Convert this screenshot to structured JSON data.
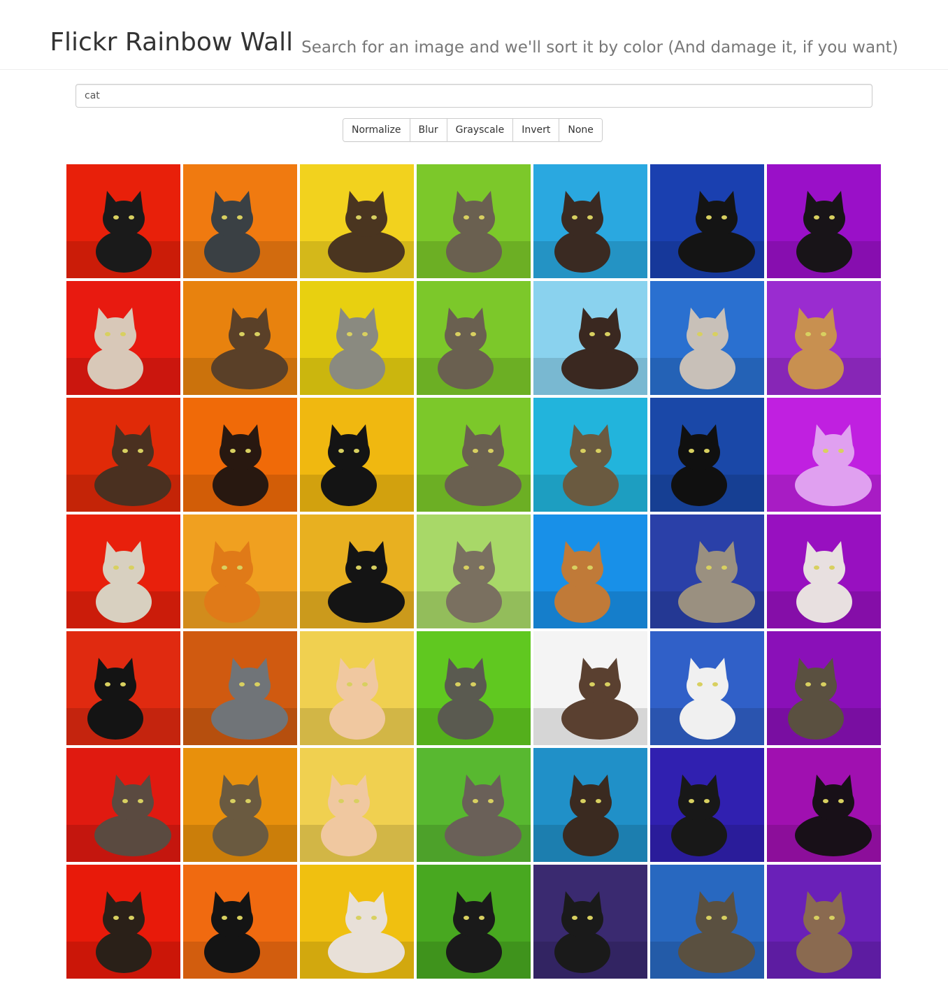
{
  "header": {
    "title": "Flickr Rainbow Wall",
    "subtitle": "Search for an image and we'll sort it by color (And damage it, if you want)"
  },
  "search": {
    "value": "cat"
  },
  "filters": [
    "Normalize",
    "Blur",
    "Grayscale",
    "Invert",
    "None"
  ],
  "grid": {
    "columns": 7,
    "rows": [
      [
        {
          "bg": "#e8200a",
          "cat": "#1a1a1a"
        },
        {
          "bg": "#f07a10",
          "cat": "#3a4044"
        },
        {
          "bg": "#f2d21e",
          "cat": "#4a3520"
        },
        {
          "bg": "#7cc82a",
          "cat": "#6a6050"
        },
        {
          "bg": "#2aa8e0",
          "cat": "#3a2a22"
        },
        {
          "bg": "#1a40b0",
          "cat": "#141414"
        },
        {
          "bg": "#9a10c8",
          "cat": "#181418"
        }
      ],
      [
        {
          "bg": "#e81a10",
          "cat": "#d8c8b8"
        },
        {
          "bg": "#e8820e",
          "cat": "#5a4028"
        },
        {
          "bg": "#e8d010",
          "cat": "#8a8a80"
        },
        {
          "bg": "#7cc82a",
          "cat": "#6a6050"
        },
        {
          "bg": "#8ad2ee",
          "cat": "#3a2820"
        },
        {
          "bg": "#2a70d0",
          "cat": "#c8c0b8"
        },
        {
          "bg": "#9a2cd0",
          "cat": "#c89050"
        }
      ],
      [
        {
          "bg": "#e02a08",
          "cat": "#4a3020"
        },
        {
          "bg": "#f06a08",
          "cat": "#281810"
        },
        {
          "bg": "#f0b810",
          "cat": "#141414"
        },
        {
          "bg": "#7cc82a",
          "cat": "#6a6050"
        },
        {
          "bg": "#22b4dc",
          "cat": "#6a5a40"
        },
        {
          "bg": "#1a48a8",
          "cat": "#101010"
        },
        {
          "bg": "#c020e0",
          "cat": "#e0a0f0"
        }
      ],
      [
        {
          "bg": "#e8200c",
          "cat": "#d8d0c0"
        },
        {
          "bg": "#f0a020",
          "cat": "#e07a18"
        },
        {
          "bg": "#e8b020",
          "cat": "#141414"
        },
        {
          "bg": "#a8d868",
          "cat": "#7a7060"
        },
        {
          "bg": "#1890e8",
          "cat": "#c07a38"
        },
        {
          "bg": "#2a40a8",
          "cat": "#9a9080"
        },
        {
          "bg": "#9810c0",
          "cat": "#e8e0e0"
        }
      ],
      [
        {
          "bg": "#e02a10",
          "cat": "#141414"
        },
        {
          "bg": "#d05a10",
          "cat": "#707478"
        },
        {
          "bg": "#f0d050",
          "cat": "#f0c8a0"
        },
        {
          "bg": "#60c820",
          "cat": "#5a5a50"
        },
        {
          "bg": "#f4f4f4",
          "cat": "#5a4030"
        },
        {
          "bg": "#3060c8",
          "cat": "#f0f0f0"
        },
        {
          "bg": "#8a10b8",
          "cat": "#5a5040"
        }
      ],
      [
        {
          "bg": "#e01a10",
          "cat": "#5a4a40"
        },
        {
          "bg": "#e8900c",
          "cat": "#6a5a40"
        },
        {
          "bg": "#f0d050",
          "cat": "#f0c8a0"
        },
        {
          "bg": "#58b830",
          "cat": "#6a6058"
        },
        {
          "bg": "#2090c8",
          "cat": "#3a2a20"
        },
        {
          "bg": "#3020b0",
          "cat": "#181818"
        },
        {
          "bg": "#a010b0",
          "cat": "#181018"
        }
      ],
      [
        {
          "bg": "#e81a0a",
          "cat": "#2a2018"
        },
        {
          "bg": "#f06a10",
          "cat": "#141414"
        },
        {
          "bg": "#f0c010",
          "cat": "#e8e0d8"
        },
        {
          "bg": "#48a820",
          "cat": "#1a1a1a"
        },
        {
          "bg": "#3a2a70",
          "cat": "#1a1a1a"
        },
        {
          "bg": "#2868c0",
          "cat": "#5a5040"
        },
        {
          "bg": "#6a20b8",
          "cat": "#8a6a50"
        }
      ]
    ]
  }
}
